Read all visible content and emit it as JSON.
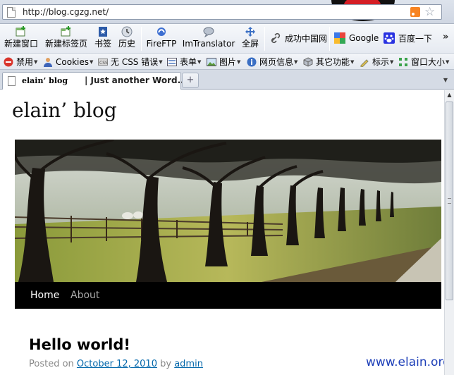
{
  "browser": {
    "url": "http://blog.cgzg.net/",
    "rss_icon": "rss-icon",
    "star_icon": "bookmark-star-icon"
  },
  "bookmarks_toolbar": {
    "items": [
      {
        "label": "新建窗口",
        "icon": "new-window-icon"
      },
      {
        "label": "新建标签页",
        "icon": "new-tab-icon"
      },
      {
        "label": "书签",
        "icon": "bookmarks-icon"
      },
      {
        "label": "历史",
        "icon": "history-icon"
      },
      {
        "label": "FireFTP",
        "icon": "fireftp-icon"
      },
      {
        "label": "ImTranslator",
        "icon": "imtranslator-icon"
      },
      {
        "label": "全屏",
        "icon": "fullscreen-icon"
      }
    ],
    "links": [
      {
        "label": "成功中国网",
        "icon": "link-icon"
      },
      {
        "label": "Google",
        "icon": "google-icon"
      },
      {
        "label": "百度一下",
        "icon": "baidu-icon"
      }
    ],
    "overflow": "»"
  },
  "dev_toolbar": {
    "items": [
      {
        "label": "禁用",
        "icon": "disable-icon"
      },
      {
        "label": "Cookies",
        "icon": "cookies-icon"
      },
      {
        "label": "无 CSS 错误",
        "icon": "css-icon"
      },
      {
        "label": "表单",
        "icon": "forms-icon"
      },
      {
        "label": "图片",
        "icon": "images-icon"
      },
      {
        "label": "网页信息",
        "icon": "info-icon"
      },
      {
        "label": "其它功能",
        "icon": "misc-icon"
      },
      {
        "label": "标示",
        "icon": "outline-icon"
      },
      {
        "label": "窗口大小",
        "icon": "resize-icon"
      }
    ]
  },
  "tabs": [
    {
      "title_part1": "elain’ blog",
      "title_part2": "| Just another Word..."
    }
  ],
  "new_tab_label": "+",
  "page": {
    "site_title": "elain’ blog",
    "nav": [
      {
        "label": "Home",
        "active": true
      },
      {
        "label": "About",
        "active": false
      }
    ],
    "post": {
      "title": "Hello world!",
      "posted_on_label": "Posted on",
      "date": "October 12, 2010",
      "by_label": "by",
      "author": "admin"
    },
    "watermark": "www.elain.org"
  },
  "colors": {
    "nav_bg": "#000000",
    "nav_active": "#ffffff",
    "nav_inactive": "#aaaaaa",
    "link": "#0066aa",
    "watermark": "#1d3fb8"
  }
}
